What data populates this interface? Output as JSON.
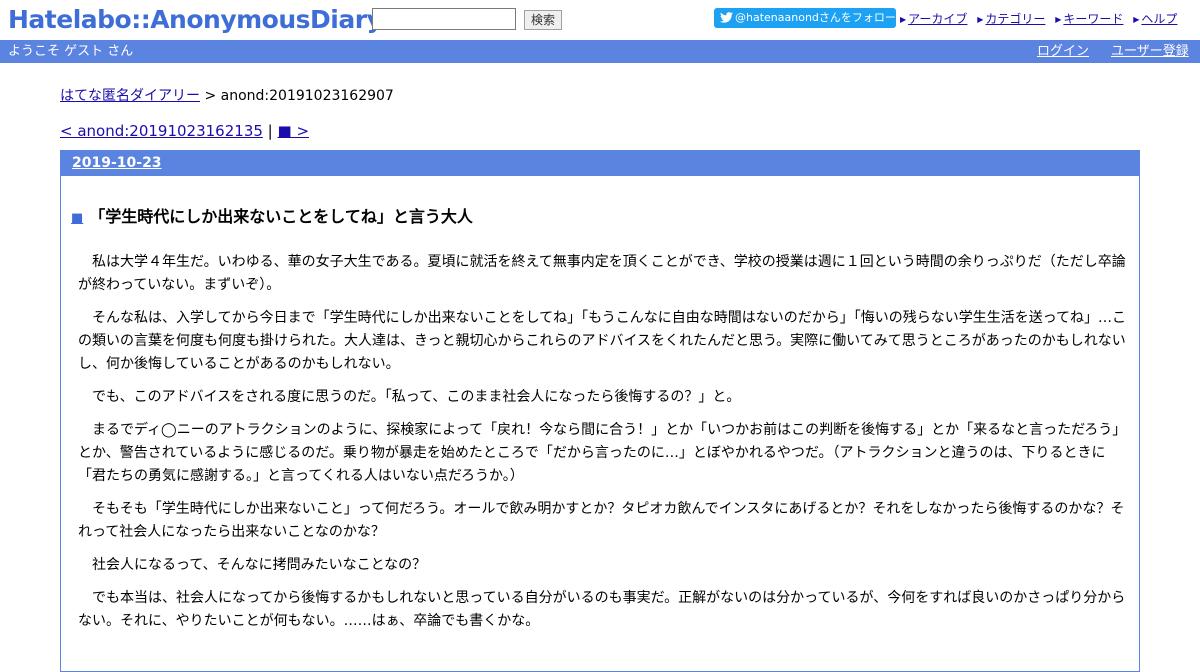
{
  "header": {
    "logo": "Hatelabo::AnonymousDiary",
    "search_placeholder": "",
    "search_button": "検索",
    "follow_button": "@hatenaanondさんをフォロー",
    "nav": [
      "アーカイブ",
      "カテゴリー",
      "キーワード",
      "ヘルプ"
    ]
  },
  "bluebar": {
    "welcome": "ようこそ ゲスト さん",
    "login": "ログイン",
    "register": "ユーザー登録"
  },
  "breadcrumb": {
    "home": "はてな匿名ダイアリー",
    "sep": " > ",
    "current": "anond:20191023162907"
  },
  "pager": {
    "prev": "< anond:20191023162135",
    "sep": " | ",
    "next": "■ >"
  },
  "entry": {
    "date": "2019-10-23",
    "title_mark": "■",
    "title": "「学生時代にしか出来ないことをしてね」と言う大人",
    "paragraphs": [
      "私は大学４年生だ。いわゆる、華の女子大生である。夏頃に就活を終えて無事内定を頂くことができ、学校の授業は週に１回という時間の余りっぷりだ（ただし卒論が終わっていない。まずいぞ）。",
      "そんな私は、入学してから今日まで「学生時代にしか出来ないことをしてね」「もうこんなに自由な時間はないのだから」「悔いの残らない学生生活を送ってね」…この類いの言葉を何度も何度も掛けられた。大人達は、きっと親切心からこれらのアドバイスをくれたんだと思う。実際に働いてみて思うところがあったのかもしれないし、何か後悔していることがあるのかもしれない。",
      "でも、このアドバイスをされる度に思うのだ。「私って、このまま社会人になったら後悔するの？」と。",
      "まるでディ◯ニーのアトラクションのように、探検家によって「戻れ！今なら間に合う！」とか「いつかお前はこの判断を後悔する」とか「来るなと言っただろう」とか、警告されているように感じるのだ。乗り物が暴走を始めたところで「だから言ったのに…」とぼやかれるやつだ。（アトラクションと違うのは、下りるときに「君たちの勇気に感謝する。」と言ってくれる人はいない点だろうか。）",
      "そもそも「学生時代にしか出来ないこと」って何だろう。オールで飲み明かすとか？タピオカ飲んでインスタにあげるとか？それをしなかったら後悔するのかな？それって社会人になったら出来ないことなのかな？",
      "社会人になるって、そんなに拷問みたいなことなの？",
      "でも本当は、社会人になってから後悔するかもしれないと思っている自分がいるのも事実だ。正解がないのは分かっているが、今何をすれば良いのかさっぱり分からない。それに、やりたいことが何もない。……はぁ、卒論でも書くかな。"
    ]
  }
}
